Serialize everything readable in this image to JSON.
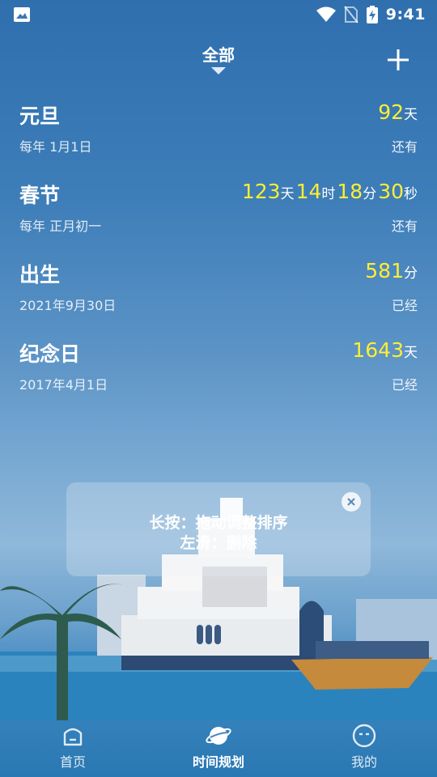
{
  "status": {
    "time": "9:41"
  },
  "header": {
    "filter_label": "全部"
  },
  "events": [
    {
      "title": "元旦",
      "subtitle": "每年 1月1日",
      "state": "还有",
      "count": [
        {
          "num": "92",
          "unit": "天"
        }
      ]
    },
    {
      "title": "春节",
      "subtitle": "每年 正月初一",
      "state": "还有",
      "count": [
        {
          "num": "123",
          "unit": "天"
        },
        {
          "num": "14",
          "unit": "时"
        },
        {
          "num": "18",
          "unit": "分"
        },
        {
          "num": "30",
          "unit": "秒"
        }
      ]
    },
    {
      "title": "出生",
      "subtitle": "2021年9月30日",
      "state": "已经",
      "count": [
        {
          "num": "581",
          "unit": "分"
        }
      ]
    },
    {
      "title": "纪念日",
      "subtitle": "2017年4月1日",
      "state": "已经",
      "count": [
        {
          "num": "1643",
          "unit": "天"
        }
      ]
    }
  ],
  "tip": {
    "line1": "长按：拖动调整排序",
    "line2": "左滑：删除"
  },
  "tabs": [
    {
      "label": "首页",
      "icon": "home-icon"
    },
    {
      "label": "时间规划",
      "icon": "planet-icon",
      "active": true
    },
    {
      "label": "我的",
      "icon": "face-icon"
    }
  ],
  "colors": {
    "highlight": "#ffee33"
  }
}
